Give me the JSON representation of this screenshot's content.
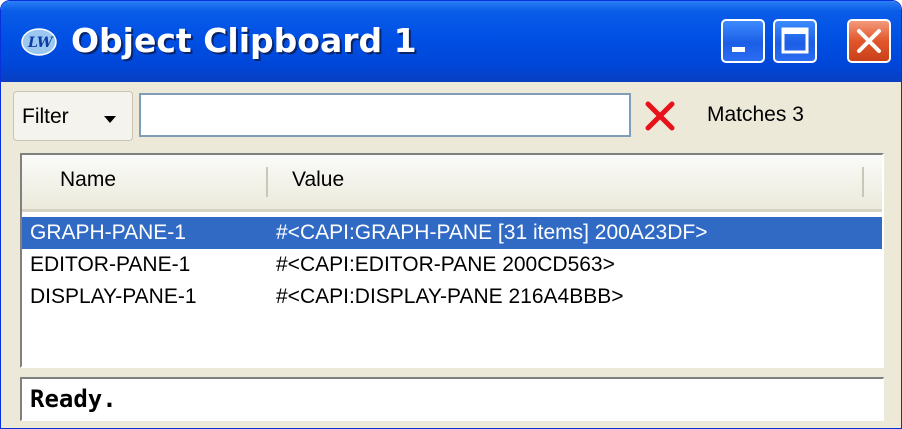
{
  "window": {
    "title": "Object Clipboard 1",
    "icon": "lispworks-app-icon",
    "controls": [
      "minimize-icon",
      "maximize-icon",
      "close-icon"
    ]
  },
  "toolbar": {
    "filter_label": "Filter",
    "filter_value": "",
    "clear_icon": "red-x-icon",
    "matches_text": "Matches 3"
  },
  "table": {
    "columns": [
      "Name",
      "Value"
    ],
    "rows": [
      {
        "name": "GRAPH-PANE-1",
        "value": "#<CAPI:GRAPH-PANE [31 items] 200A23DF>",
        "selected": true
      },
      {
        "name": "EDITOR-PANE-1",
        "value": "#<CAPI:EDITOR-PANE  200CD563>",
        "selected": false
      },
      {
        "name": "DISPLAY-PANE-1",
        "value": "#<CAPI:DISPLAY-PANE  216A4BBB>",
        "selected": false
      }
    ]
  },
  "status": {
    "text": "Ready."
  },
  "colors": {
    "titlebar": "#0050e5",
    "selection": "#316ac5",
    "clear_red": "#e8121a",
    "window_bg": "#ece9d8"
  }
}
